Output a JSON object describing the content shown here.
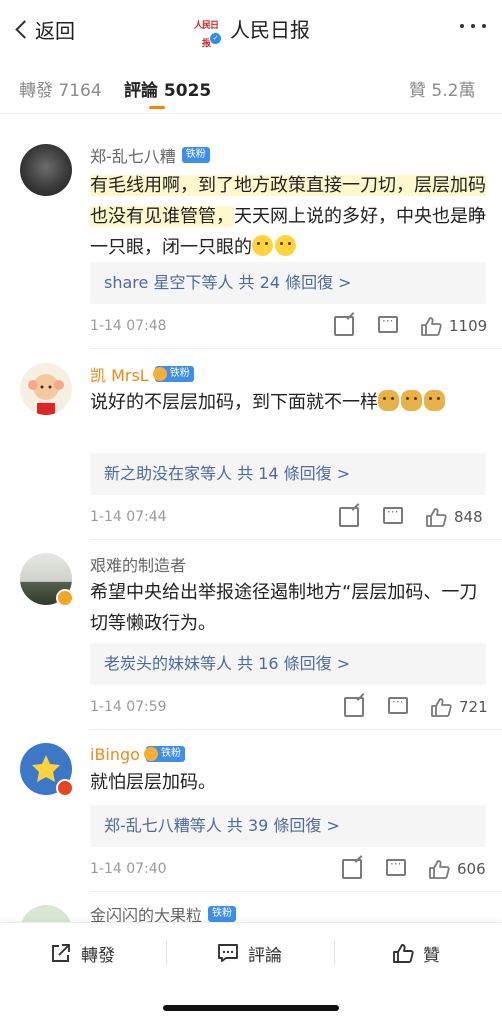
{
  "nav": {
    "back_label": "返回",
    "title": "人民日报",
    "logo_text": "人民日报"
  },
  "tabs": {
    "reposts_label": "轉發",
    "reposts_count": "7164",
    "comments_label": "評論",
    "comments_count": "5025",
    "likes_label": "贊",
    "likes_count": "5.2萬"
  },
  "accent_color": "#ff8200",
  "comments": [
    {
      "name": "郑-乱七八糟",
      "badge": "铁粉",
      "text_highlight": "有毛线用啊，到了地方政策直接一刀切，层层加码也没有见谁管管，",
      "text": "天天网上说的多好，中央也是睁一只眼，闭一只眼的",
      "reply_users": "share 星空下等人",
      "reply_more": "共 24 條回復 >",
      "time": "1-14 07:48",
      "likes": "1109"
    },
    {
      "name": "凯 MrsL",
      "badge": "铁粉",
      "text": "说好的不层层加码，到下面就不一样",
      "reply_users": "新之助没在家等人",
      "reply_more": "共 14 條回復 >",
      "time": "1-14 07:44",
      "likes": "848"
    },
    {
      "name": "艰难的制造者",
      "text": "希望中央给出举报途径遏制地方“层层加码、一刀切等懒政行为。",
      "reply_users": "老炭头的妹妹等人",
      "reply_more": "共 16 條回復 >",
      "time": "1-14 07:59",
      "likes": "721"
    },
    {
      "name": "iBingo",
      "badge": "铁粉",
      "text": "就怕层层加码。",
      "reply_users": "郑-乱七八糟等人",
      "reply_more": "共 39 條回復 >",
      "time": "1-14 07:40",
      "likes": "606"
    },
    {
      "name": "金闪闪的大果粒",
      "badge": "铁粉"
    }
  ],
  "bottom_bar": {
    "repost_label": "轉發",
    "comment_label": "評論",
    "like_label": "贊"
  }
}
